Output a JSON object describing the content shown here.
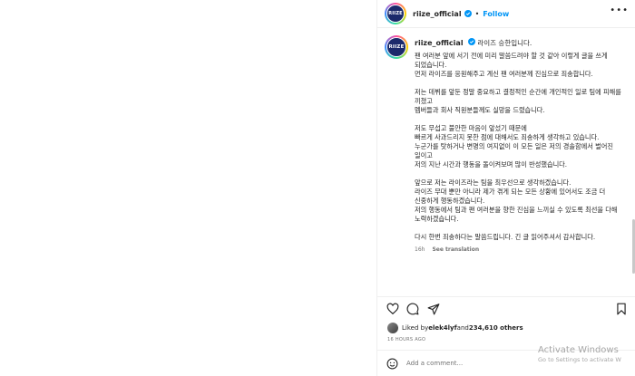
{
  "account": {
    "username": "riize_official",
    "avatar_text": "RIIZE",
    "follow_label": "Follow",
    "separator": "•"
  },
  "caption": {
    "title": "라이즈 승한입니다.",
    "body": "팬 여러분 앞에 서기 전에 미리 말씀드려야 할 것 같아 이렇게 글을 쓰게 되었습니다.\n먼저 라이즈를 응원해주고 계신 팬 여러분께 진심으로 죄송합니다.\n\n저는 데뷔를 앞둔 정말 중요하고 결정적인 순간에 개인적인 일로 팀에 피해를 끼쳤고\n멤버들과 회사 직원분들께도 실망을 드렸습니다.\n\n저도 무섭고 불안한 마음이 앞섰기 때문에\n빠르게 사과드리지 못한 점에 대해서도 죄송하게 생각하고 있습니다.\n누군가를 탓하거나 변명의 여지없이 이 모든 일은 저의 경솔함에서 벌어진 일이고\n저의 지난 시간과 행동을 돌이켜보며 많이 반성했습니다.\n\n앞으로 저는 라이즈라는 팀을 최우선으로 생각하겠습니다.\n라이즈 무대 뿐만 아니라 제가 겪게 되는 모든 상황에 있어서도 조금 더 신중하게 행동하겠습니다.\n저의 행동에서 팀과 팬 여러분을 향한 진심을 느끼실 수 있도록 최선을 다해 노력하겠습니다.\n\n다시 한번 죄송하다는 말씀드립니다. 긴 글 읽어주셔서 감사합니다.",
    "time_ago": "16h",
    "see_translation": "See translation"
  },
  "icons": {
    "like": "heart-icon",
    "comment": "comment-icon",
    "share": "share-icon",
    "save": "bookmark-icon",
    "more": "more-options-icon",
    "emoji": "emoji-icon",
    "verified": "verified-badge-icon"
  },
  "likes": {
    "prefix": "Liked by ",
    "user": "elek4lyf",
    "middle": " and ",
    "others": "234,610 others"
  },
  "timestamp": "16 HOURS AGO",
  "comment": {
    "placeholder": "Add a comment..."
  },
  "watermark": {
    "title": "Activate Windows",
    "subtitle": "Go to Settings to activate W"
  },
  "colors": {
    "accent": "#0095f6",
    "verified": "#0095f6",
    "avatar_bg": "#1b2a6b",
    "text": "#262626",
    "muted": "#737373"
  }
}
